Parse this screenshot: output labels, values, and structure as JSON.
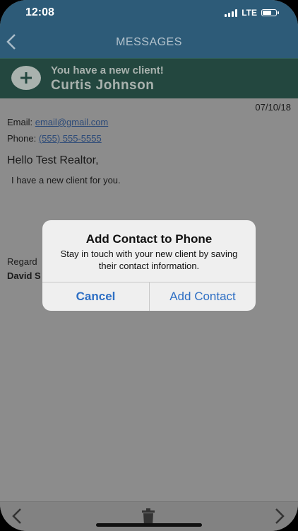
{
  "status_bar": {
    "time": "12:08",
    "network": "LTE"
  },
  "nav": {
    "back_icon": "chevron-left-icon",
    "title": "MESSAGES"
  },
  "banner": {
    "subtitle": "You have a new client!",
    "name": "Curtis Johnson",
    "icon": "plus-icon"
  },
  "message": {
    "date": "07/10/18",
    "email_label": "Email:",
    "email_value": "email@gmail.com",
    "phone_label": "Phone:",
    "phone_value": "(555) 555-5555",
    "greeting": "Hello Test Realtor,",
    "body": "I have a new client for you.",
    "regards": "Regard",
    "signer": "David S"
  },
  "dialog": {
    "title": "Add Contact to Phone",
    "message": "Stay in touch with your new client by saving their contact information.",
    "cancel_label": "Cancel",
    "confirm_label": "Add Contact"
  },
  "toolbar": {
    "prev_icon": "chevron-left-icon",
    "delete_icon": "trash-icon",
    "next_icon": "chevron-right-icon"
  },
  "colors": {
    "nav_bg": "#2d5b78",
    "banner_bg": "#23473f",
    "dialog_button": "#2e6fc4"
  }
}
